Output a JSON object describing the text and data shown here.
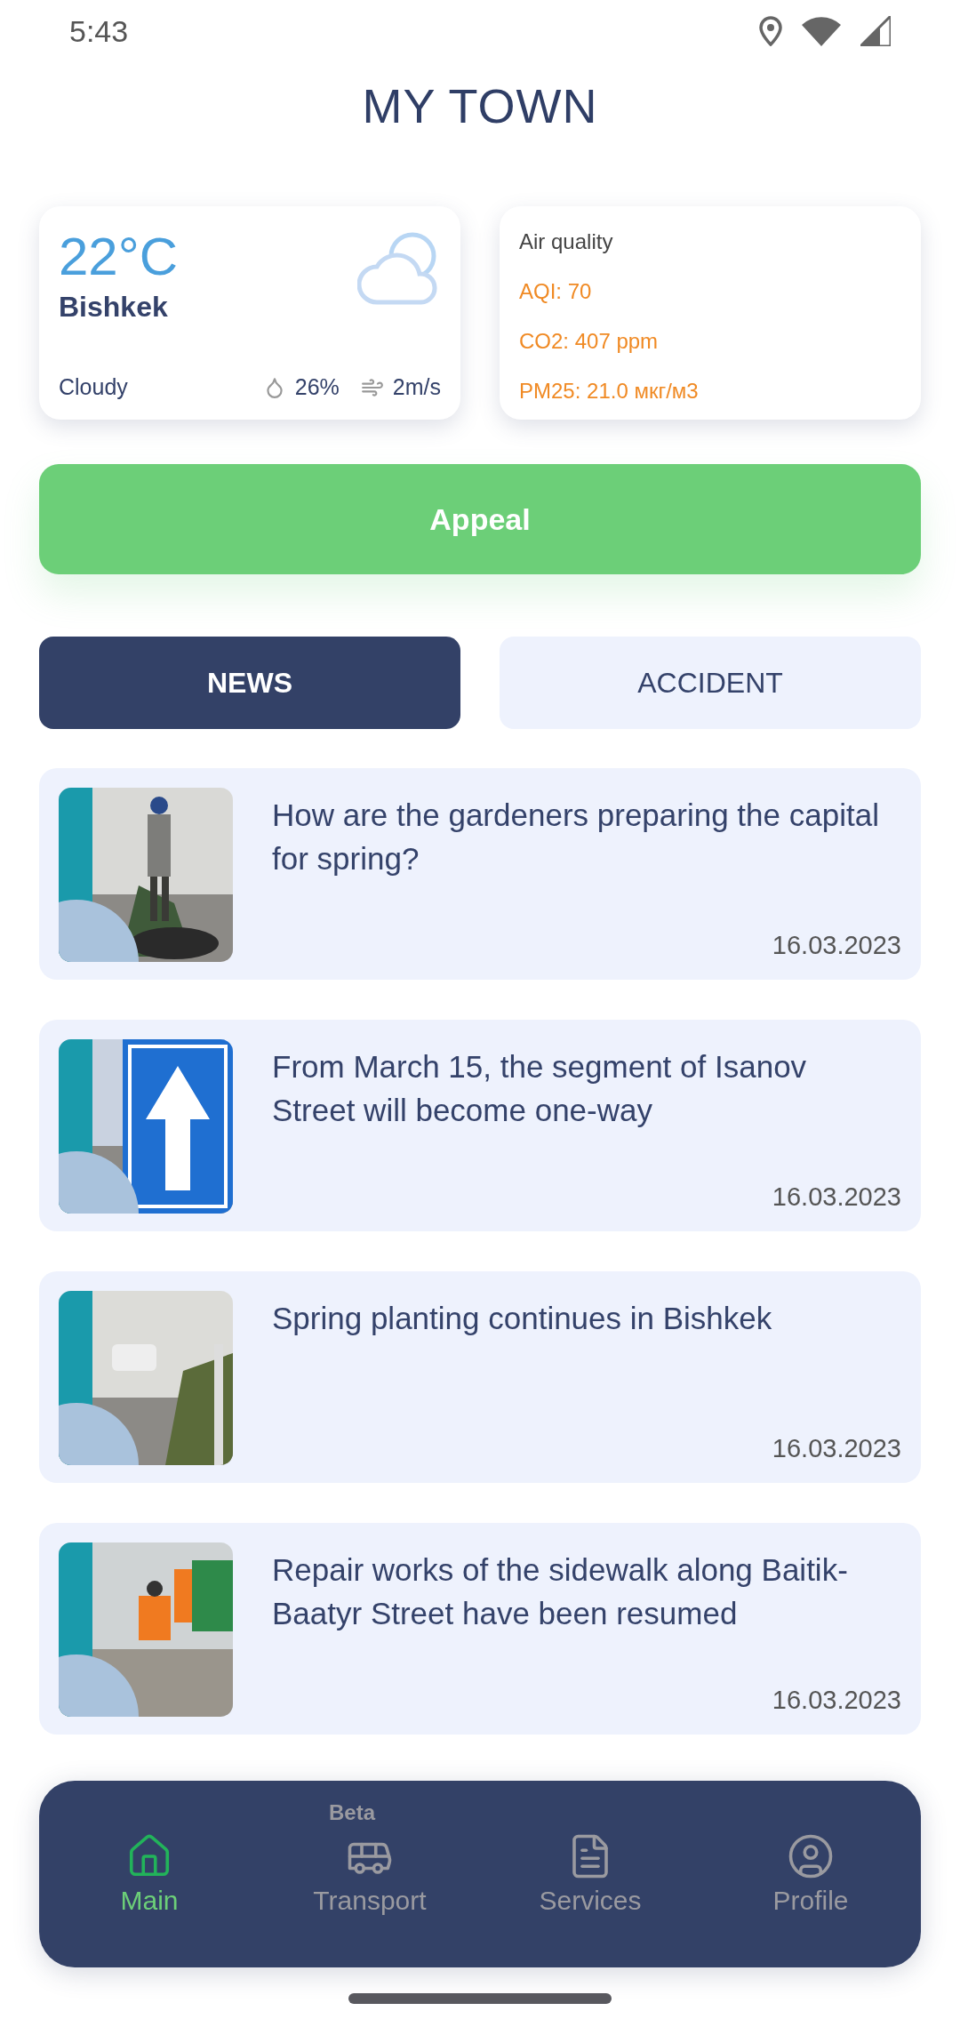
{
  "status_bar": {
    "time": "5:43"
  },
  "title": "MY TOWN",
  "weather": {
    "temperature": "22°C",
    "city": "Bishkek",
    "condition": "Cloudy",
    "humidity": "26%",
    "wind": "2m/s"
  },
  "air_quality": {
    "title": "Air quality",
    "lines": [
      "AQI: 70",
      "CO2: 407 ppm",
      "PM25: 21.0 мкг/м3"
    ]
  },
  "appeal_button": "Appeal",
  "tabs": [
    {
      "label": "NEWS",
      "selected": true
    },
    {
      "label": "ACCIDENT",
      "selected": false
    }
  ],
  "news": [
    {
      "title": "How are the gardeners preparing the capital for spring?",
      "date": "16.03.2023"
    },
    {
      "title": "From March 15, the segment of Isanov Street will become one-way",
      "date": "16.03.2023"
    },
    {
      "title": "Spring planting continues in Bishkek",
      "date": "16.03.2023"
    },
    {
      "title": "Repair works of the sidewalk along Baitik-Baatyr Street have been resumed",
      "date": "16.03.2023"
    }
  ],
  "bottom_nav": [
    {
      "label": "Main",
      "kind": "home",
      "selected": true
    },
    {
      "label": "Transport",
      "kind": "bus",
      "selected": false,
      "badge": "Beta"
    },
    {
      "label": "Services",
      "kind": "document",
      "selected": false
    },
    {
      "label": "Profile",
      "kind": "profile",
      "selected": false
    }
  ]
}
